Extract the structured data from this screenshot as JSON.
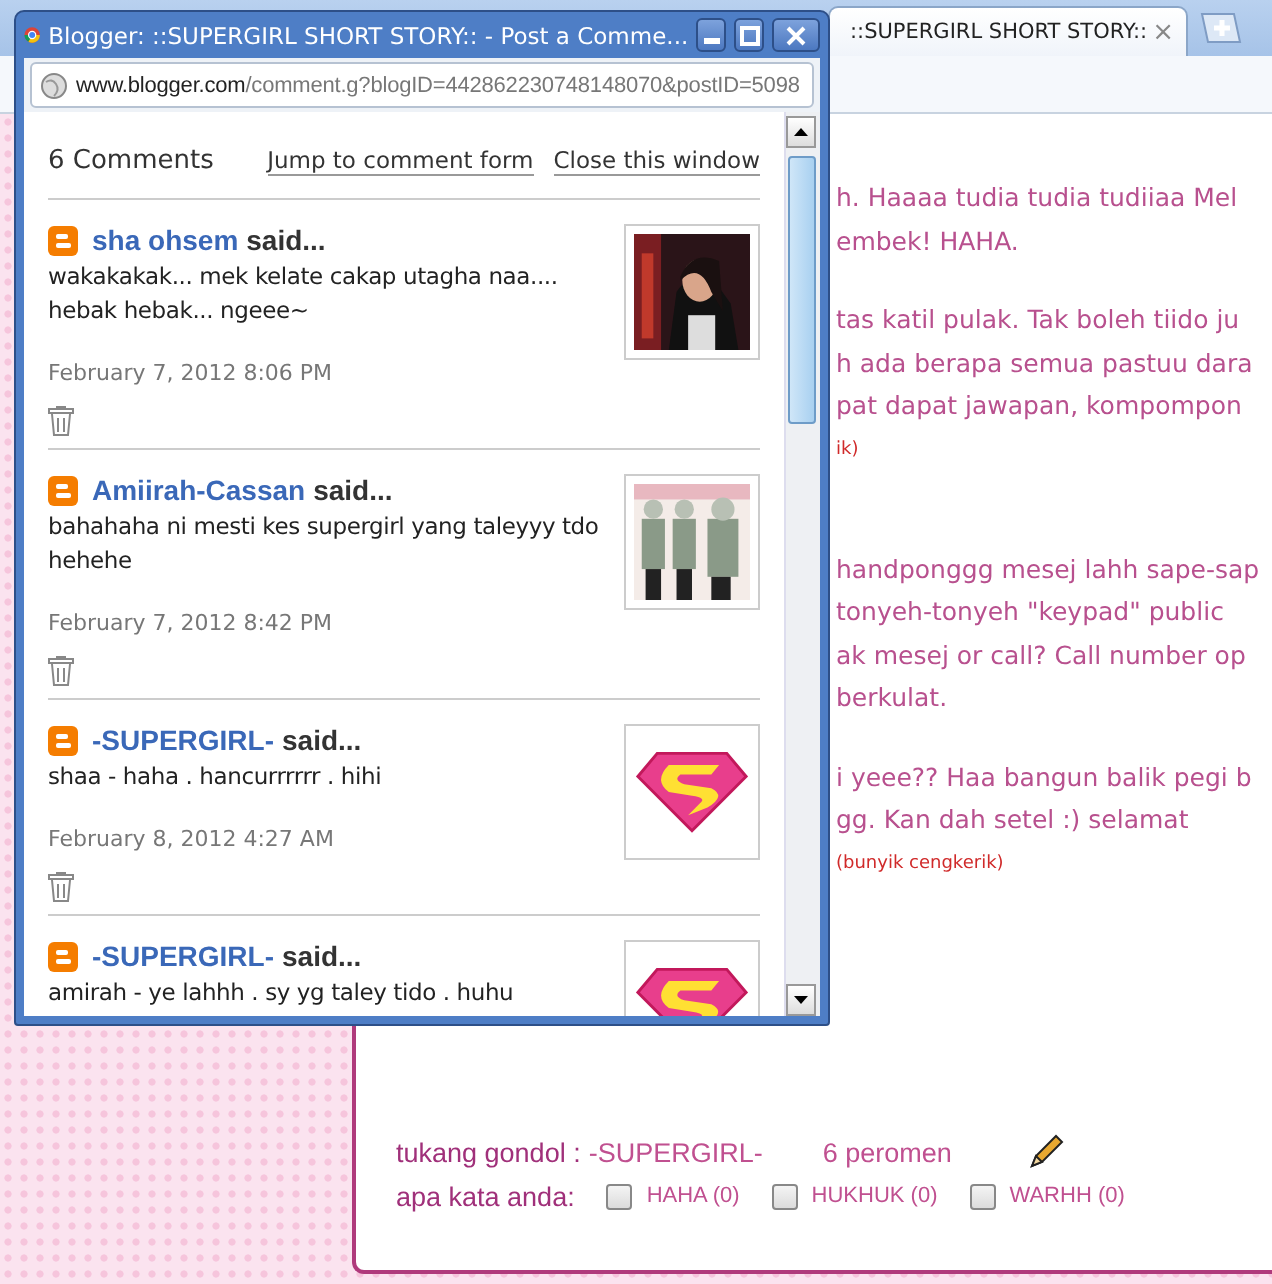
{
  "browser": {
    "tab": {
      "title": "::SUPERGIRL SHORT STORY::",
      "close": "×"
    }
  },
  "post": {
    "paragraphs": [
      {
        "kind": "text",
        "lines": [
          "h. Haaaa tudia tudia tudiiaa Mel",
          "embek! HAHA."
        ]
      },
      {
        "kind": "text",
        "lines": [
          "tas katil pulak. Tak boleh tiido ju",
          "h ada berapa semua pastuu dara",
          "pat dapat jawapan, kompompon"
        ]
      },
      {
        "kind": "note",
        "lines": [
          "ik)"
        ]
      },
      {
        "kind": "text",
        "lines": [
          "handponggg mesej lahh sape-sap",
          "tonyeh-tonyeh \"keypad\" public",
          "ak mesej or call?  Call number op",
          "berkulat."
        ]
      },
      {
        "kind": "text",
        "lines": [
          "i yeee?? Haa bangun balik pegi b",
          "gg. Kan dah setel :) selamat"
        ]
      },
      {
        "kind": "note",
        "lines": [
          "(bunyik cengkerik)"
        ]
      }
    ],
    "footer": {
      "author_label": "tukang gondol :",
      "author": "-SUPERGIRL-",
      "count": "6 peromen",
      "reactions_label": "apa kata anda:",
      "reactions": [
        {
          "label": "HAHA (0)",
          "checked": false
        },
        {
          "label": "HUKHUK (0)",
          "checked": false
        },
        {
          "label": "WARHH (0)",
          "checked": false
        }
      ]
    }
  },
  "popup": {
    "title": "Blogger: ::SUPERGIRL SHORT STORY:: - Post a Comme...",
    "url_domain": "www.blogger.com",
    "url_path": "/comment.g?blogID=442862230748148070&postID=5098",
    "comment_count": "6 Comments",
    "links": [
      "Jump to comment form",
      "Close this window"
    ],
    "comments": [
      {
        "author": "sha ohsem",
        "said": "said...",
        "body": "wakakakak... mek kelate cakap utagha naa.... hebak hebak... ngeee~",
        "date": "February 7, 2012 8:06 PM",
        "avatar": {
          "kind": "portrait"
        }
      },
      {
        "author": "Amiirah-Cassan",
        "said": "said...",
        "body": "bahahaha ni mesti kes supergirl yang taleyyy tdo hehehe",
        "date": "February 7, 2012 8:42 PM",
        "avatar": {
          "kind": "group"
        }
      },
      {
        "author": "-SUPERGIRL-",
        "said": "said...",
        "body": "shaa - haha . hancurrrrrr . hihi",
        "date": "February 8, 2012 4:27 AM",
        "avatar": {
          "kind": "shield"
        }
      },
      {
        "author": "-SUPERGIRL-",
        "said": "said...",
        "body": "amirah - ye lahhh . sy yg taley tido . huhu",
        "avatar": {
          "kind": "shield"
        }
      }
    ]
  }
}
